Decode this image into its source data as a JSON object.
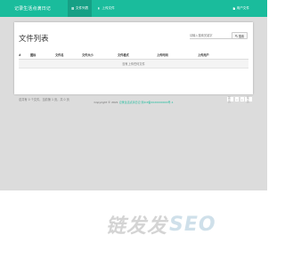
{
  "navbar": {
    "brand": "记录生活点滴日记",
    "items": [
      {
        "label": "文件列表",
        "icon": "list-icon",
        "active": true
      },
      {
        "label": "上传文件",
        "icon": "user-icon",
        "active": false
      }
    ],
    "right_label": "用户文件",
    "right_icon": "file-icon",
    "color": "#1abc9c"
  },
  "card": {
    "title": "文件列表",
    "search": {
      "placeholder": "请输入搜索关键字",
      "button_label": "搜索",
      "button_icon": "search-icon"
    },
    "table": {
      "columns": [
        "#",
        "图标",
        "文件名",
        "文件大小",
        "文件格式",
        "上传时间",
        "上传用户"
      ],
      "empty_text": "没有上传任何文件"
    },
    "summary": "总共有 0 个文件，当前第 1 页，共 0 页",
    "pager": [
      "首页",
      "«",
      "»",
      "尾页"
    ]
  },
  "footer": {
    "copyright": "Copyright © 2021 ",
    "site_link": "记录生活点滴日记",
    "icp": " 浙ICP备2020000000号-1"
  },
  "watermark": {
    "part1": "链发发",
    "part2": "SEO"
  }
}
